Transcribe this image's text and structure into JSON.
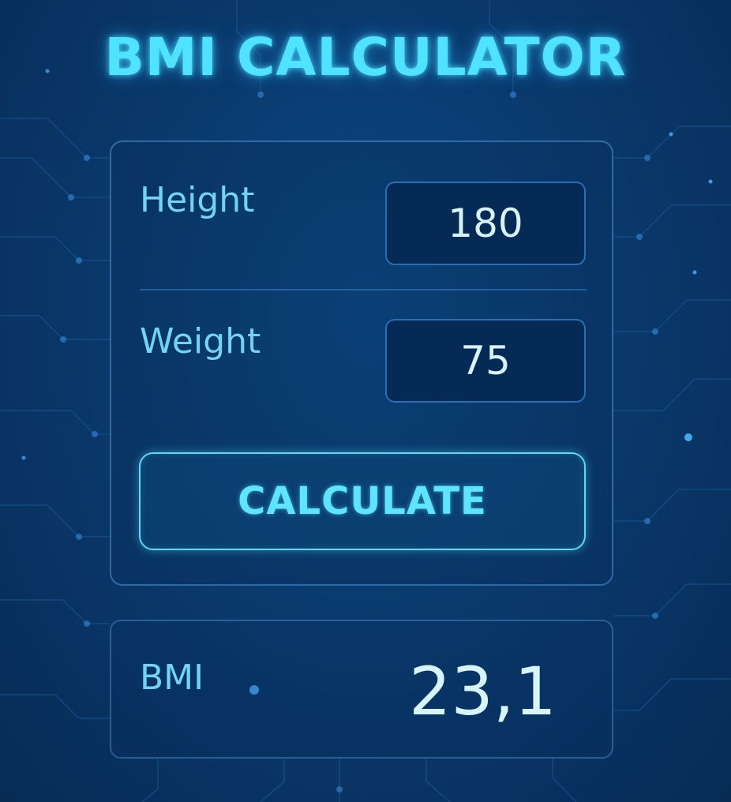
{
  "title": "BMI CALCULATOR",
  "form": {
    "height": {
      "label": "Height",
      "value": "180"
    },
    "weight": {
      "label": "Weight",
      "value": "75"
    },
    "calculate_label": "CALCULATE"
  },
  "result": {
    "label": "BMI",
    "value": "23,1"
  },
  "colors": {
    "accent": "#4fe3ff",
    "background": "#0a3a6e",
    "input_bg": "#062a56",
    "text_light": "#d8f4fb"
  }
}
